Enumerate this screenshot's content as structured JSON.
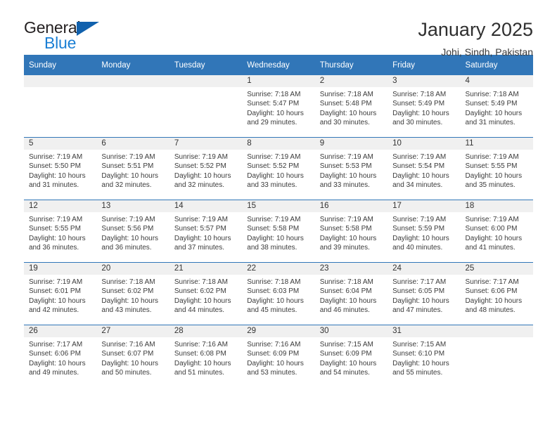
{
  "brand": {
    "name_top": "General",
    "name_bottom": "Blue",
    "triangle_color": "#1161ad",
    "blue_color": "#1b7fd4"
  },
  "header": {
    "title": "January 2025",
    "subtitle": "Johi, Sindh, Pakistan",
    "accent_color": "#3176b8",
    "band_color": "#f0f0f0"
  },
  "calendar": {
    "weekday_headers": [
      "Sunday",
      "Monday",
      "Tuesday",
      "Wednesday",
      "Thursday",
      "Friday",
      "Saturday"
    ],
    "labels": {
      "sunrise": "Sunrise:",
      "sunset": "Sunset:",
      "daylight": "Daylight:"
    },
    "weeks": [
      [
        {
          "day": ""
        },
        {
          "day": ""
        },
        {
          "day": ""
        },
        {
          "day": "1",
          "sunrise": "Sunrise: 7:18 AM",
          "sunset": "Sunset: 5:47 PM",
          "daylight_line1": "Daylight: 10 hours",
          "daylight_line2": "and 29 minutes."
        },
        {
          "day": "2",
          "sunrise": "Sunrise: 7:18 AM",
          "sunset": "Sunset: 5:48 PM",
          "daylight_line1": "Daylight: 10 hours",
          "daylight_line2": "and 30 minutes."
        },
        {
          "day": "3",
          "sunrise": "Sunrise: 7:18 AM",
          "sunset": "Sunset: 5:49 PM",
          "daylight_line1": "Daylight: 10 hours",
          "daylight_line2": "and 30 minutes."
        },
        {
          "day": "4",
          "sunrise": "Sunrise: 7:18 AM",
          "sunset": "Sunset: 5:49 PM",
          "daylight_line1": "Daylight: 10 hours",
          "daylight_line2": "and 31 minutes."
        }
      ],
      [
        {
          "day": "5",
          "sunrise": "Sunrise: 7:19 AM",
          "sunset": "Sunset: 5:50 PM",
          "daylight_line1": "Daylight: 10 hours",
          "daylight_line2": "and 31 minutes."
        },
        {
          "day": "6",
          "sunrise": "Sunrise: 7:19 AM",
          "sunset": "Sunset: 5:51 PM",
          "daylight_line1": "Daylight: 10 hours",
          "daylight_line2": "and 32 minutes."
        },
        {
          "day": "7",
          "sunrise": "Sunrise: 7:19 AM",
          "sunset": "Sunset: 5:52 PM",
          "daylight_line1": "Daylight: 10 hours",
          "daylight_line2": "and 32 minutes."
        },
        {
          "day": "8",
          "sunrise": "Sunrise: 7:19 AM",
          "sunset": "Sunset: 5:52 PM",
          "daylight_line1": "Daylight: 10 hours",
          "daylight_line2": "and 33 minutes."
        },
        {
          "day": "9",
          "sunrise": "Sunrise: 7:19 AM",
          "sunset": "Sunset: 5:53 PM",
          "daylight_line1": "Daylight: 10 hours",
          "daylight_line2": "and 33 minutes."
        },
        {
          "day": "10",
          "sunrise": "Sunrise: 7:19 AM",
          "sunset": "Sunset: 5:54 PM",
          "daylight_line1": "Daylight: 10 hours",
          "daylight_line2": "and 34 minutes."
        },
        {
          "day": "11",
          "sunrise": "Sunrise: 7:19 AM",
          "sunset": "Sunset: 5:55 PM",
          "daylight_line1": "Daylight: 10 hours",
          "daylight_line2": "and 35 minutes."
        }
      ],
      [
        {
          "day": "12",
          "sunrise": "Sunrise: 7:19 AM",
          "sunset": "Sunset: 5:55 PM",
          "daylight_line1": "Daylight: 10 hours",
          "daylight_line2": "and 36 minutes."
        },
        {
          "day": "13",
          "sunrise": "Sunrise: 7:19 AM",
          "sunset": "Sunset: 5:56 PM",
          "daylight_line1": "Daylight: 10 hours",
          "daylight_line2": "and 36 minutes."
        },
        {
          "day": "14",
          "sunrise": "Sunrise: 7:19 AM",
          "sunset": "Sunset: 5:57 PM",
          "daylight_line1": "Daylight: 10 hours",
          "daylight_line2": "and 37 minutes."
        },
        {
          "day": "15",
          "sunrise": "Sunrise: 7:19 AM",
          "sunset": "Sunset: 5:58 PM",
          "daylight_line1": "Daylight: 10 hours",
          "daylight_line2": "and 38 minutes."
        },
        {
          "day": "16",
          "sunrise": "Sunrise: 7:19 AM",
          "sunset": "Sunset: 5:58 PM",
          "daylight_line1": "Daylight: 10 hours",
          "daylight_line2": "and 39 minutes."
        },
        {
          "day": "17",
          "sunrise": "Sunrise: 7:19 AM",
          "sunset": "Sunset: 5:59 PM",
          "daylight_line1": "Daylight: 10 hours",
          "daylight_line2": "and 40 minutes."
        },
        {
          "day": "18",
          "sunrise": "Sunrise: 7:19 AM",
          "sunset": "Sunset: 6:00 PM",
          "daylight_line1": "Daylight: 10 hours",
          "daylight_line2": "and 41 minutes."
        }
      ],
      [
        {
          "day": "19",
          "sunrise": "Sunrise: 7:19 AM",
          "sunset": "Sunset: 6:01 PM",
          "daylight_line1": "Daylight: 10 hours",
          "daylight_line2": "and 42 minutes."
        },
        {
          "day": "20",
          "sunrise": "Sunrise: 7:18 AM",
          "sunset": "Sunset: 6:02 PM",
          "daylight_line1": "Daylight: 10 hours",
          "daylight_line2": "and 43 minutes."
        },
        {
          "day": "21",
          "sunrise": "Sunrise: 7:18 AM",
          "sunset": "Sunset: 6:02 PM",
          "daylight_line1": "Daylight: 10 hours",
          "daylight_line2": "and 44 minutes."
        },
        {
          "day": "22",
          "sunrise": "Sunrise: 7:18 AM",
          "sunset": "Sunset: 6:03 PM",
          "daylight_line1": "Daylight: 10 hours",
          "daylight_line2": "and 45 minutes."
        },
        {
          "day": "23",
          "sunrise": "Sunrise: 7:18 AM",
          "sunset": "Sunset: 6:04 PM",
          "daylight_line1": "Daylight: 10 hours",
          "daylight_line2": "and 46 minutes."
        },
        {
          "day": "24",
          "sunrise": "Sunrise: 7:17 AM",
          "sunset": "Sunset: 6:05 PM",
          "daylight_line1": "Daylight: 10 hours",
          "daylight_line2": "and 47 minutes."
        },
        {
          "day": "25",
          "sunrise": "Sunrise: 7:17 AM",
          "sunset": "Sunset: 6:06 PM",
          "daylight_line1": "Daylight: 10 hours",
          "daylight_line2": "and 48 minutes."
        }
      ],
      [
        {
          "day": "26",
          "sunrise": "Sunrise: 7:17 AM",
          "sunset": "Sunset: 6:06 PM",
          "daylight_line1": "Daylight: 10 hours",
          "daylight_line2": "and 49 minutes."
        },
        {
          "day": "27",
          "sunrise": "Sunrise: 7:16 AM",
          "sunset": "Sunset: 6:07 PM",
          "daylight_line1": "Daylight: 10 hours",
          "daylight_line2": "and 50 minutes."
        },
        {
          "day": "28",
          "sunrise": "Sunrise: 7:16 AM",
          "sunset": "Sunset: 6:08 PM",
          "daylight_line1": "Daylight: 10 hours",
          "daylight_line2": "and 51 minutes."
        },
        {
          "day": "29",
          "sunrise": "Sunrise: 7:16 AM",
          "sunset": "Sunset: 6:09 PM",
          "daylight_line1": "Daylight: 10 hours",
          "daylight_line2": "and 53 minutes."
        },
        {
          "day": "30",
          "sunrise": "Sunrise: 7:15 AM",
          "sunset": "Sunset: 6:09 PM",
          "daylight_line1": "Daylight: 10 hours",
          "daylight_line2": "and 54 minutes."
        },
        {
          "day": "31",
          "sunrise": "Sunrise: 7:15 AM",
          "sunset": "Sunset: 6:10 PM",
          "daylight_line1": "Daylight: 10 hours",
          "daylight_line2": "and 55 minutes."
        },
        {
          "day": ""
        }
      ]
    ]
  }
}
